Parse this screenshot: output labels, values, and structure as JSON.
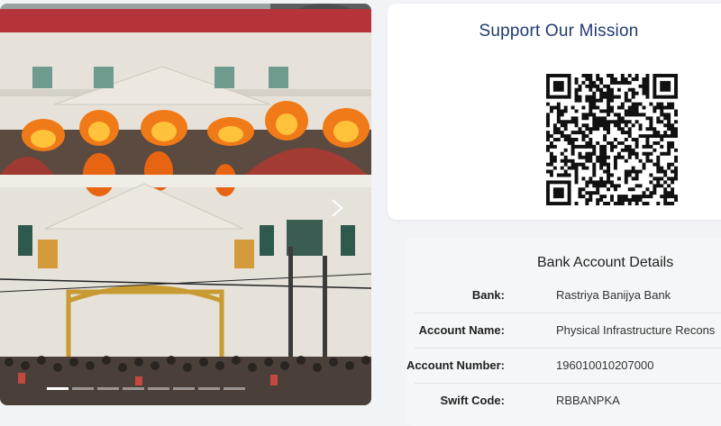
{
  "mission": {
    "title": "Support Our Mission",
    "qr_icon": "qr-code-icon"
  },
  "slider": {
    "next_icon": "chevron-right-icon",
    "dot_count": 8,
    "active_dot": 0
  },
  "bank": {
    "title": "Bank Account Details",
    "rows": [
      {
        "label": "Bank:",
        "value": "Rastriya Banijya Bank"
      },
      {
        "label": "Account Name:",
        "value": "Physical Infrastructure Recons"
      },
      {
        "label": "Account Number:",
        "value": "196010010207000"
      },
      {
        "label": "Swift Code:",
        "value": "RBBANPKA"
      }
    ]
  },
  "colors": {
    "mission_title": "#1f3b73",
    "page_bg": "#f1f3f6",
    "bank_card_bg": "#f5f6f7"
  }
}
